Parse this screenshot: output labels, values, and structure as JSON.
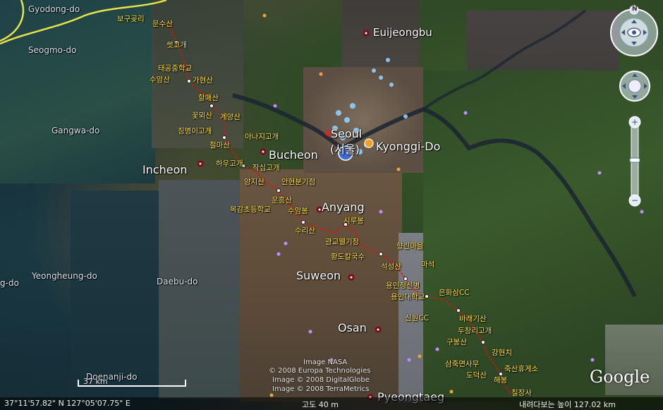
{
  "map": {
    "places": [
      {
        "name": "Gyodong-do",
        "kind": "region"
      },
      {
        "name": "Seogmo-do",
        "kind": "region"
      },
      {
        "name": "Gangwa-do",
        "kind": "region"
      },
      {
        "name": "Yeongheung-do",
        "kind": "region"
      },
      {
        "name": "g-do",
        "kind": "region"
      },
      {
        "name": "Daebu-do",
        "kind": "region"
      },
      {
        "name": "Doenanji-do",
        "kind": "region"
      },
      {
        "name": "Euijeongbu",
        "kind": "city"
      },
      {
        "name": "Incheon",
        "kind": "city"
      },
      {
        "name": "Bucheon",
        "kind": "city"
      },
      {
        "name": "Seoul",
        "kind": "city"
      },
      {
        "name": "(서울)",
        "kind": "city"
      },
      {
        "name": "Kyonggi-Do",
        "kind": "city"
      },
      {
        "name": "Anyang",
        "kind": "city"
      },
      {
        "name": "Suweon",
        "kind": "city"
      },
      {
        "name": "Osan",
        "kind": "city"
      },
      {
        "name": "Pyeongtaeg",
        "kind": "city"
      }
    ],
    "route_labels": [
      "보구곶리",
      "문수산",
      "썻고개",
      "태공중학교",
      "수암산",
      "가현산",
      "할매산",
      "꽃뫼산",
      "계양산",
      "징명이고개",
      "아나지고개",
      "철마산",
      "하우고개",
      "작십고개",
      "양지산",
      "안현분기점",
      "운흥산",
      "목감초등학교",
      "수암봉",
      "수리산",
      "시루봉",
      "광교웰기장",
      "황도칼국수",
      "향린마을",
      "석성산",
      "마석",
      "용인정신병",
      "용인대학교",
      "은화삼CC",
      "신원CC",
      "바래기산",
      "두창리고개",
      "구봉산",
      "강현치",
      "삼죽면사무",
      "죽산휴게소",
      "도덕산",
      "칠장사",
      "해봉"
    ]
  },
  "copyright": {
    "lines": [
      "Image NASA",
      "© 2008 Europa Technologies",
      "Image © 2008 DigitalGlobe",
      "Image © 2008 TerraMetrics"
    ]
  },
  "scale": {
    "label": "37 km"
  },
  "status": {
    "coords": "37°11'57.82\" N   127°05'07.75\" E",
    "elevation": "고도   40 m",
    "altitude": "내려다보는 높이   127.02 km"
  },
  "logo": {
    "text": "Google"
  },
  "nav": {
    "north_label": "N"
  }
}
